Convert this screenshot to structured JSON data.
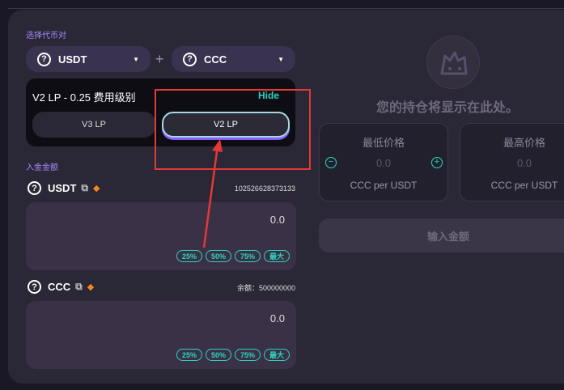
{
  "pair": {
    "section_label": "选择代币对",
    "token_a": "USDT",
    "token_b": "CCC",
    "plus": "+"
  },
  "fee": {
    "title": "V2 LP - 0.25 费用级别",
    "hide_label": "Hide",
    "v3_label": "V3 LP",
    "v2_label": "V2 LP"
  },
  "deposit": {
    "section_label": "入金金额",
    "usdt": {
      "name": "USDT",
      "balance": "102526628373133",
      "amount": "0.0"
    },
    "ccc": {
      "name": "CCC",
      "balance": "余额：500000000",
      "amount": "0.0"
    },
    "percent_buttons": [
      "25%",
      "50%",
      "75%",
      "最大"
    ]
  },
  "position": {
    "empty_text": "您的持仓将显示在此处。",
    "min_price": {
      "label": "最低价格",
      "value": "0.0",
      "unit": "CCC per USDT"
    },
    "max_price": {
      "label": "最高价格",
      "value": "0.0",
      "unit": "CCC per USDT"
    },
    "enter_amount": "输入金额"
  },
  "colors": {
    "accent_teal": "#2dd4bf",
    "accent_purple": "#8b5cf6",
    "annotation_red": "#e53935"
  },
  "icons": [
    "question-token-icon",
    "caret-down-icon",
    "copy-icon",
    "metamask-fox-icon",
    "minus-circle-icon",
    "plus-circle-icon"
  ]
}
